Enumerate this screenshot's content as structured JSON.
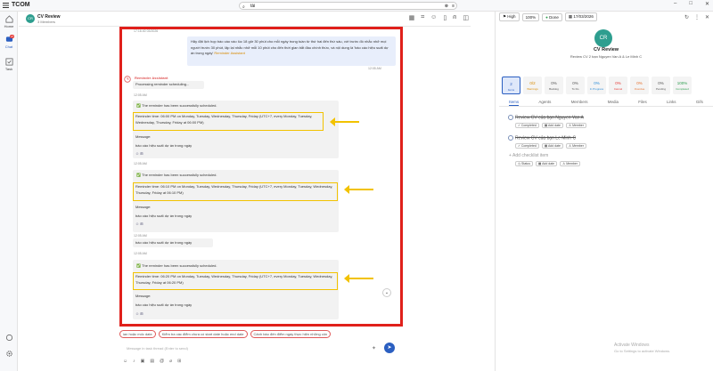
{
  "app": {
    "name": "TCOM"
  },
  "search": {
    "value": "tài"
  },
  "nav": {
    "home": "Home",
    "chat": "Chat",
    "chat_badge": "27",
    "task": "Task"
  },
  "chat": {
    "title": "CV Review",
    "subtitle": "3 Members",
    "avatar": "CR",
    "top_time": "17:16:40 03/2026",
    "user_msg": "Hãy đặt lịch họp báo cáo vào lúc 18 giờ 30 phút cho mỗi ngày trong tuần từ thứ hai đến thứ sáu, với trước đó nhắc nhở mọi người trước 30 phút, lặp lại nhắc nhở mỗi 10 phút cho đến thời gian bắt đầu chính thức, và nội dung là 'báo cáo hiệu suất dự án trong ngày'",
    "user_mention": "Reminder Assistant",
    "user_time": "12:05 AM",
    "assistant_name": "Reminder Assistant",
    "processing": "Processing reminder scheduling...",
    "t1": "12:05 AM",
    "t2": "12:05 AM",
    "t3": "12:05 AM",
    "t4": "12:05 AM",
    "t5": "12:05 AM",
    "success": "✅ The reminder has been successfully scheduled.",
    "rt1": "Reminder time: 06:00 PM on Monday, Tuesday, Wednesday, Thursday, Friday (UTC+7, every Monday, Tuesday, Wednesday, Thursday, Friday at 06:00 PM)",
    "rt2": "Reminder time: 06:10 PM on Monday, Tuesday, Wednesday, Thursday, Friday (UTC+7, every Monday, Tuesday, Wednesday, Thursday, Friday at 06:10 PM)",
    "rt3": "Reminder time: 06:20 PM on Monday, Tuesday, Wednesday, Thursday, Friday (UTC+7, every Monday, Tuesday, Wednesday, Thursday, Friday at 06:20 PM)",
    "message_label": "Message:",
    "message_body": "báo cáo hiệu suất dự án trong ngày",
    "chips": [
      "ian hoặc mốc date",
      "Kiểm tra các điểm chưa có start date hoặc end date",
      "Cảnh báo đến điểm ngày thực hiện những côn"
    ],
    "input_placeholder": "Message in task thread (Enter to send)",
    "send": "➤"
  },
  "right": {
    "priority": "High",
    "progress": "100%",
    "status": "Done",
    "date": "17/03/2026",
    "avatar": "CR",
    "title": "CV Review",
    "desc": "Review CV 2 bạn Nguyen Van A & Le Minh C",
    "stats": [
      {
        "v": "2",
        "l": "Items",
        "c": "#2b5fc1"
      },
      {
        "v": "0/2",
        "l": "Warnings",
        "c": "#d88a00"
      },
      {
        "v": "0%",
        "l": "Backlog",
        "c": "#555"
      },
      {
        "v": "0%",
        "l": "To Do",
        "c": "#555"
      },
      {
        "v": "0%",
        "l": "In Progress",
        "c": "#2b8cd8"
      },
      {
        "v": "0%",
        "l": "Cancel",
        "c": "#e53935"
      },
      {
        "v": "0%",
        "l": "Overdue",
        "c": "#e5702d"
      },
      {
        "v": "0%",
        "l": "Pending",
        "c": "#555"
      },
      {
        "v": "100%",
        "l": "Completed",
        "c": "#2e9e4f"
      }
    ],
    "tabs": [
      "Items",
      "Agents",
      "Members",
      "Media",
      "Files",
      "Links",
      "Gifs"
    ],
    "items": [
      {
        "title": "Review CV của bạn Nguyen Van A",
        "status": "Completed",
        "add_date": "Add date",
        "member": "Member"
      },
      {
        "title": "Review CV của bạn Le Minh C",
        "status": "Completed",
        "add_date": "Add date",
        "member": "Member"
      }
    ],
    "add_item": "Add checklist item",
    "add_status": "Status",
    "add_date": "Add date",
    "add_member": "Member"
  },
  "watermark": {
    "title": "Activate Windows",
    "sub": "Go to Settings to activate Windows."
  }
}
